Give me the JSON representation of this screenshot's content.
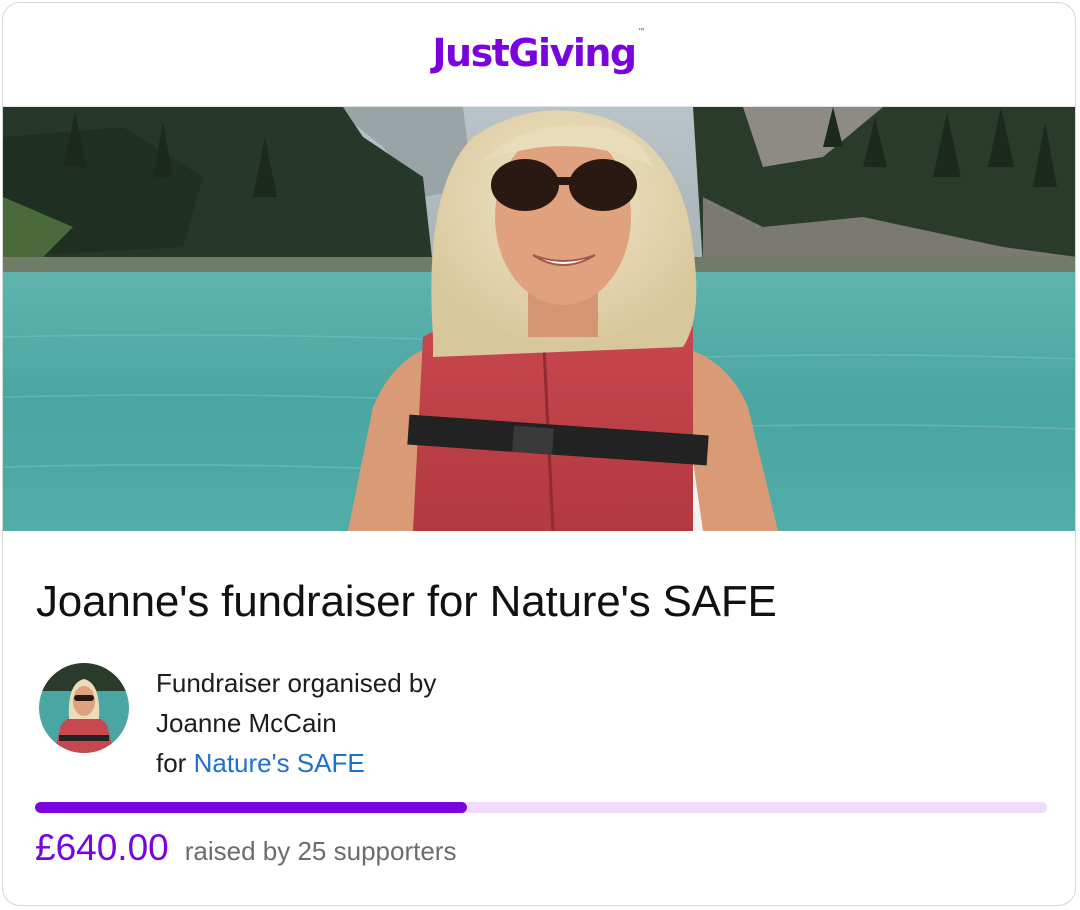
{
  "brand": {
    "logo_text": "JustGiving",
    "trademark": "™",
    "accent_color": "#7a04dd",
    "link_color": "#1f6fce"
  },
  "hero_image": {
    "description_icon": "photo-woman-in-life-jacket-on-lake"
  },
  "fundraiser": {
    "title": "Joanne's fundraiser for Nature's SAFE",
    "organised_by_label": "Fundraiser organised by",
    "organiser_name": "Joanne McCain",
    "for_label": "for",
    "charity_name": "Nature's SAFE"
  },
  "progress": {
    "fraction": 0.427,
    "amount_raised": "£640.00",
    "supporters_text": "raised by 25 supporters"
  }
}
